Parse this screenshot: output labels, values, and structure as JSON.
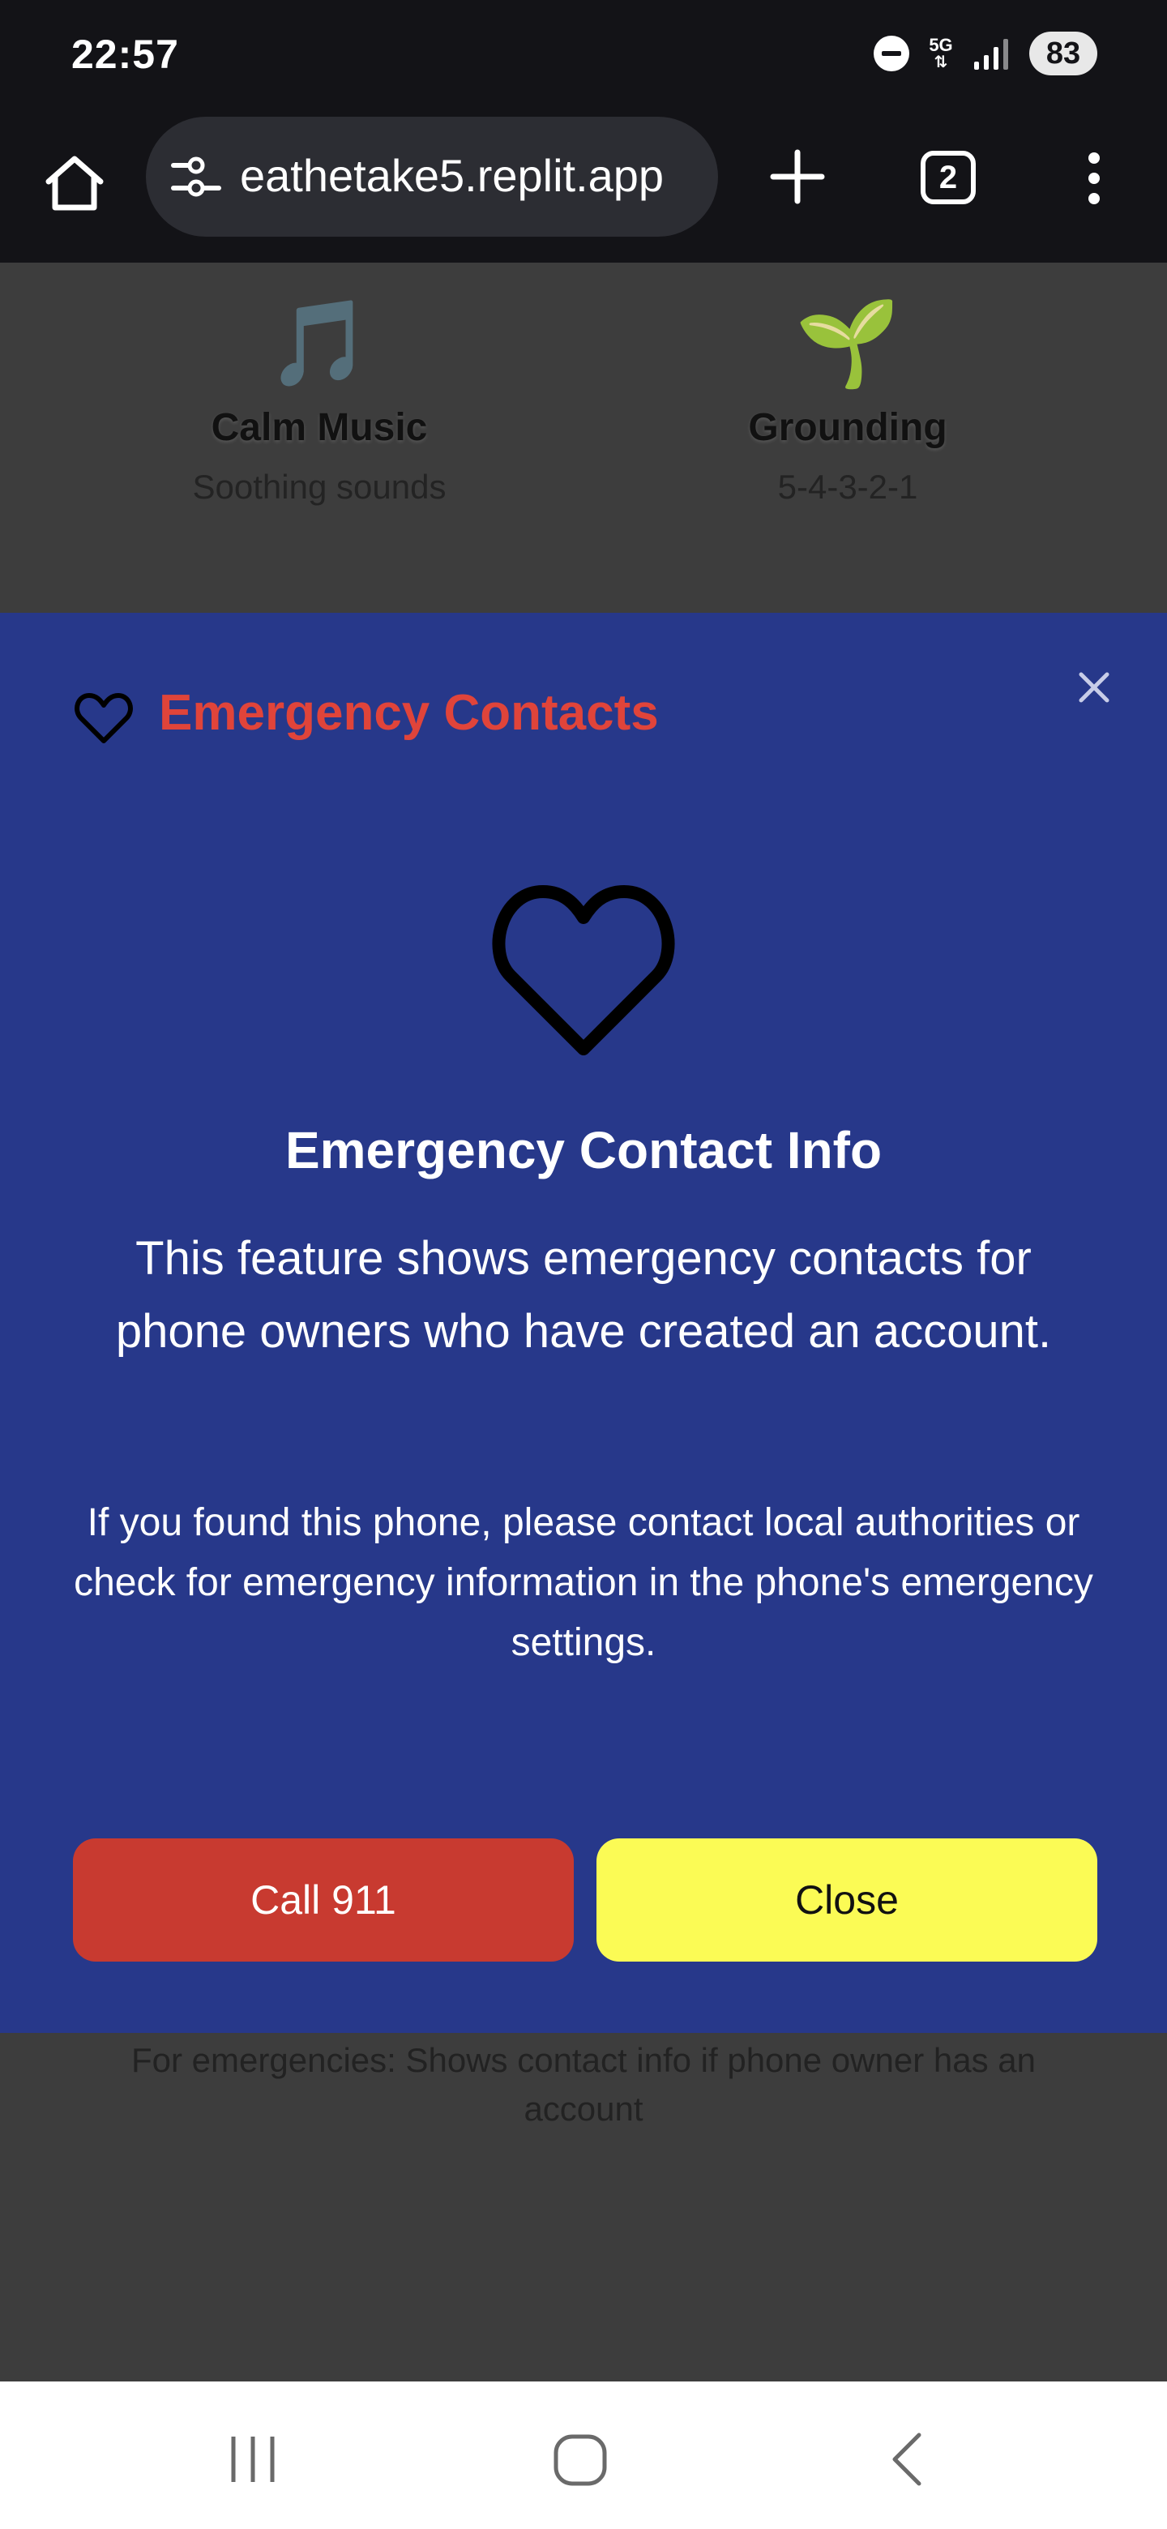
{
  "status_bar": {
    "time": "22:57",
    "network": "5G",
    "battery": "83",
    "icons": [
      "do-not-disturb-icon",
      "5g-data-icon",
      "signal-icon",
      "battery-icon"
    ]
  },
  "browser": {
    "url": "eathetake5.replit.app",
    "tab_count": "2",
    "icons": [
      "home-icon",
      "site-settings-icon",
      "new-tab-icon",
      "tab-switcher-icon",
      "menu-icon"
    ]
  },
  "page": {
    "features": [
      {
        "emoji": "🎵",
        "title": "Calm Music",
        "subtitle": "Soothing sounds"
      },
      {
        "emoji": "🌱",
        "title": "Grounding",
        "subtitle": "5-4-3-2-1"
      }
    ],
    "footnote": "For emergencies: Shows contact info if phone owner has an account"
  },
  "modal": {
    "title": "Emergency Contacts",
    "heading": "Emergency Contact Info",
    "body": "This feature shows emergency contacts for phone owners who have created an account.",
    "note": "If you found this phone, please contact local authorities or check for emergency information in the phone's emergency settings.",
    "call_button": "Call 911",
    "close_button": "Close",
    "colors": {
      "background": "#27388a",
      "title": "#e0443a",
      "call_button": "#c83a30",
      "close_button": "#fbfb55"
    }
  },
  "nav_bar": {
    "icons": [
      "recent-apps-icon",
      "home-nav-icon",
      "back-icon"
    ]
  }
}
